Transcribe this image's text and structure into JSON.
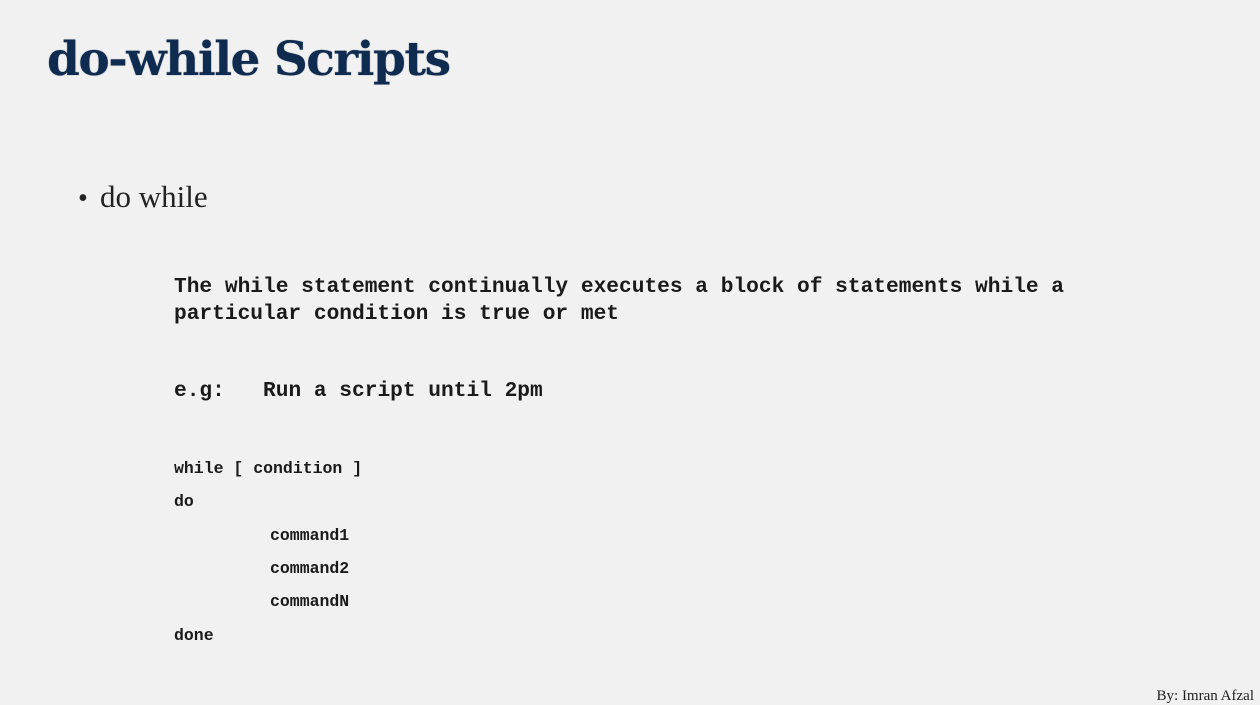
{
  "slide": {
    "title": "do-while Scripts",
    "bullet": "do while",
    "description": "The while statement continually executes a block of statements while a\nparticular condition is true or met",
    "example_label": "e.g:",
    "example_text": "Run a script until 2pm",
    "code": {
      "while_line": "while [ condition ]",
      "do_line": "do",
      "command1": "command1",
      "command2": "command2",
      "commandN": "commandN",
      "done_line": "done"
    },
    "footer": "By: Imran Afzal"
  }
}
